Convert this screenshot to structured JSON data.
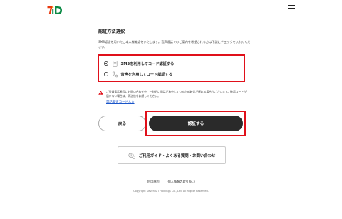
{
  "header": {
    "logo_text": "7iD",
    "logo_colors": {
      "seven": "#e8380d",
      "i": "#0a8a45",
      "d": "#0a8a45",
      "accent": "#f39800"
    },
    "menu_icon": "hamburger-icon"
  },
  "main": {
    "title": "認証方法選択",
    "description": "SMS認証を用いたご本人様確認をいたします。音声通話でのご案内を希望される方は下記にチェックを入れてください。",
    "options": [
      {
        "label": "SMSを利用してコード認証する",
        "icon": "sms-icon",
        "checked": true
      },
      {
        "label": "音声を利用してコード認証する",
        "icon": "phone-icon",
        "checked": false
      }
    ],
    "warning": {
      "icon": "warning-icon",
      "text": "ご登録電話番号にお問い合わせ中、一時的に通話が集中しているため着信が遅れる場合がございます。確認コードが届かない場合は、再送信をお試しください。"
    },
    "phone_change_link": "電話変更コード入力",
    "highlight_color": "#e0101a",
    "buttons": {
      "back": "戻る",
      "submit": "認証する"
    },
    "guide": {
      "icon": "help-icon",
      "label": "ご利用ガイド・よくある質問・お問い合わせ"
    }
  },
  "footer": {
    "links": [
      "利用規約",
      "個人情報の取り扱い"
    ],
    "copyright": "Copyright Seven & i Holdings Co., Ltd. All Rights Reserved."
  }
}
